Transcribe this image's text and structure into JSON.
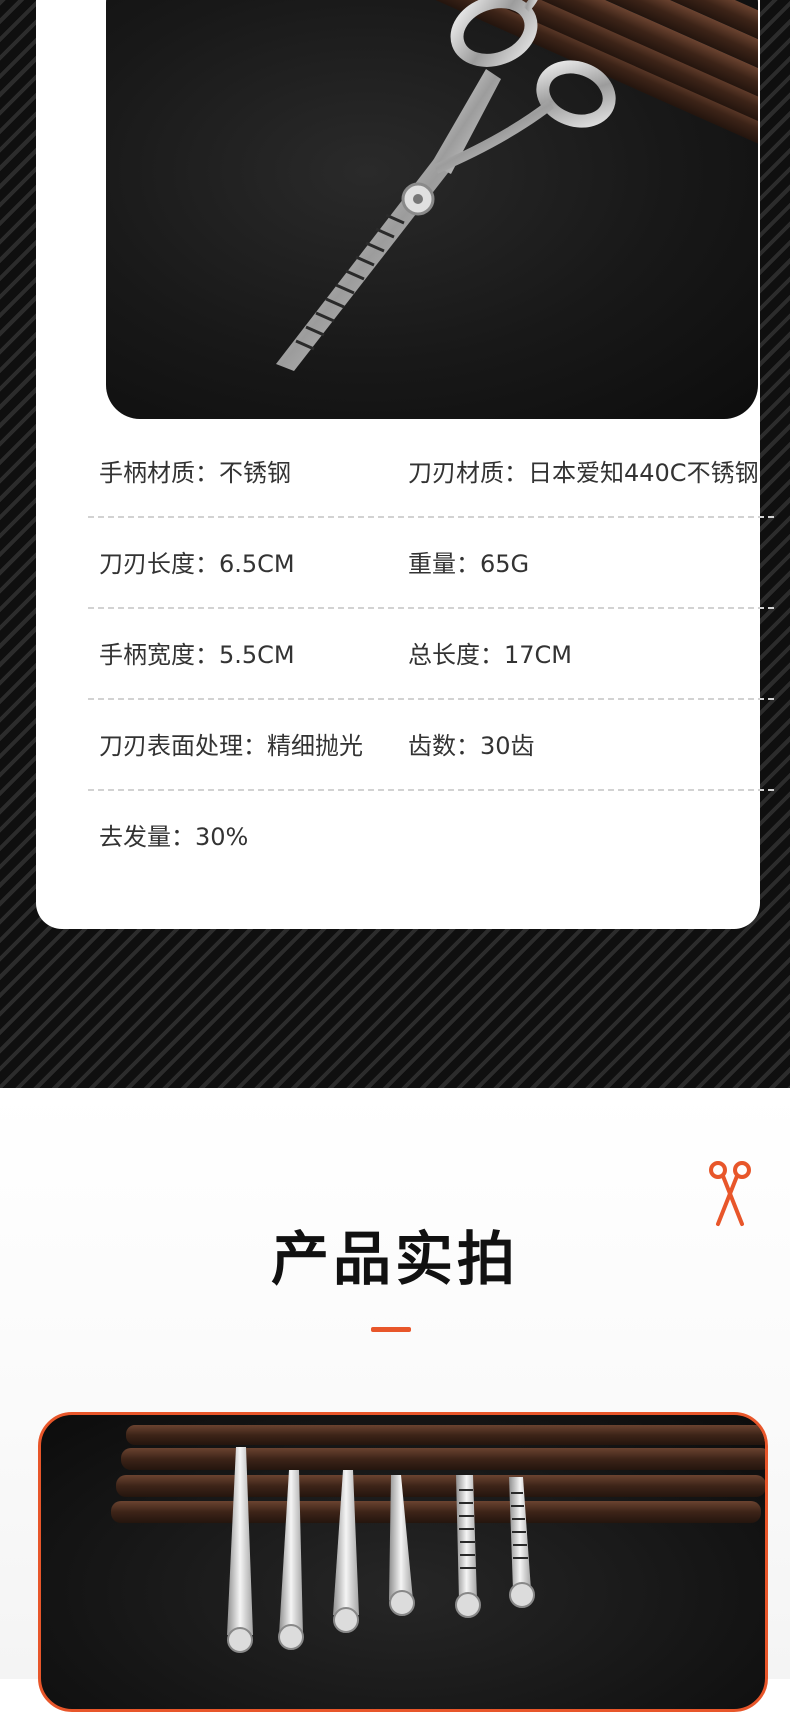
{
  "specs": {
    "rows": [
      [
        "手柄材质：不锈钢",
        "刀刃材质：日本爱知440C不锈钢"
      ],
      [
        "刀刃长度：6.5CM",
        "重量：65G"
      ],
      [
        "手柄宽度：5.5CM",
        "总长度：17CM"
      ],
      [
        "刀刃表面处理：精细抛光",
        "齿数：30齿"
      ],
      [
        "去发量：30%",
        ""
      ]
    ]
  },
  "section": {
    "title": "产品实拍",
    "icon": "scissors-icon"
  },
  "colors": {
    "accent": "#e8562a",
    "dark_background": "#121212",
    "text": "#333333"
  }
}
